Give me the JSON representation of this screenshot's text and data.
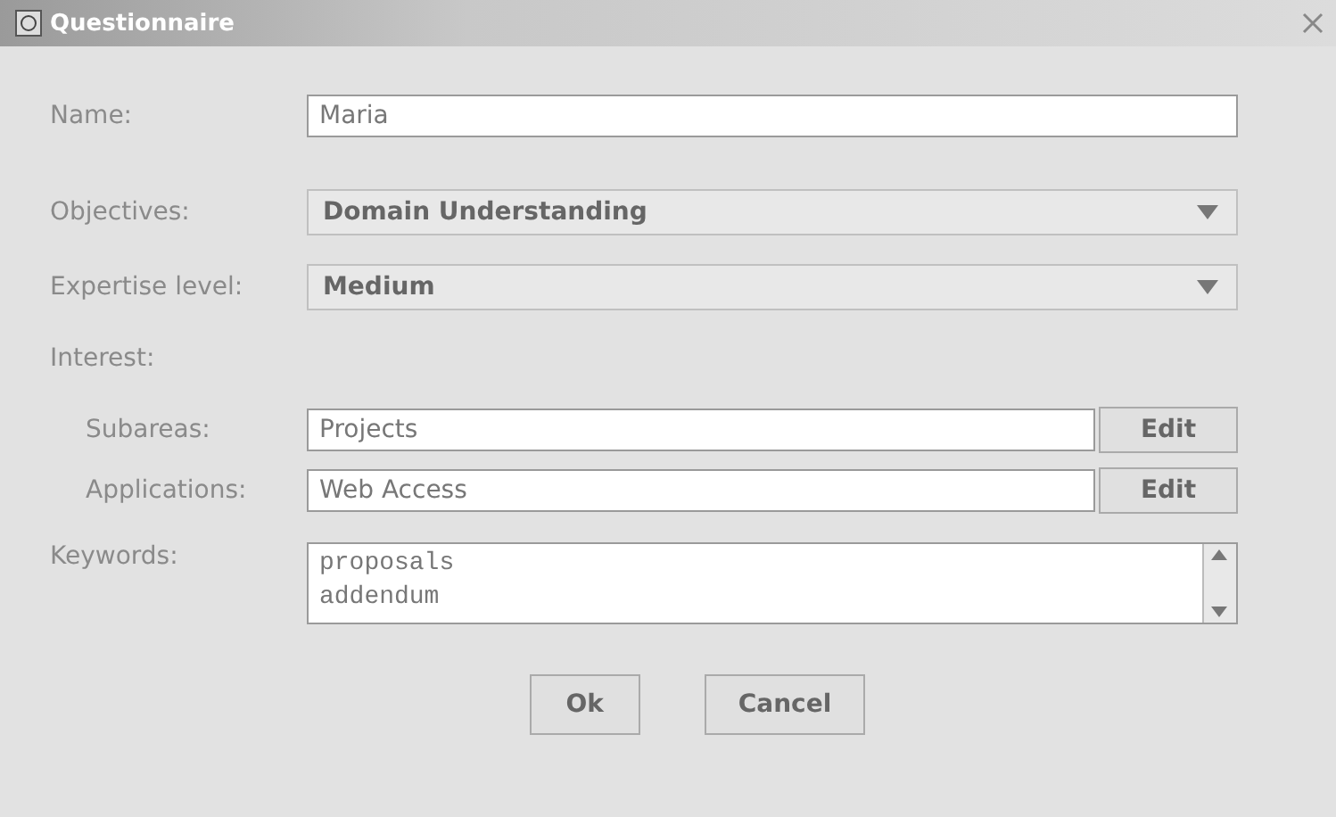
{
  "window": {
    "title": "Questionnaire"
  },
  "name": {
    "label": "Name:",
    "value": "Maria"
  },
  "selects": [
    {
      "label": "Objectives:",
      "value": "Domain Understanding"
    },
    {
      "label": "Expertise level:",
      "value": "Medium"
    }
  ],
  "interest": {
    "label": "Interest:",
    "items": [
      {
        "label": "Subareas:",
        "value": "Projects",
        "button": "Edit"
      },
      {
        "label": "Applications:",
        "value": "Web Access",
        "button": "Edit"
      }
    ]
  },
  "keywords": {
    "label": "Keywords:",
    "lines": [
      "proposals",
      "addendum"
    ]
  },
  "buttons": [
    "Ok",
    "Cancel"
  ]
}
